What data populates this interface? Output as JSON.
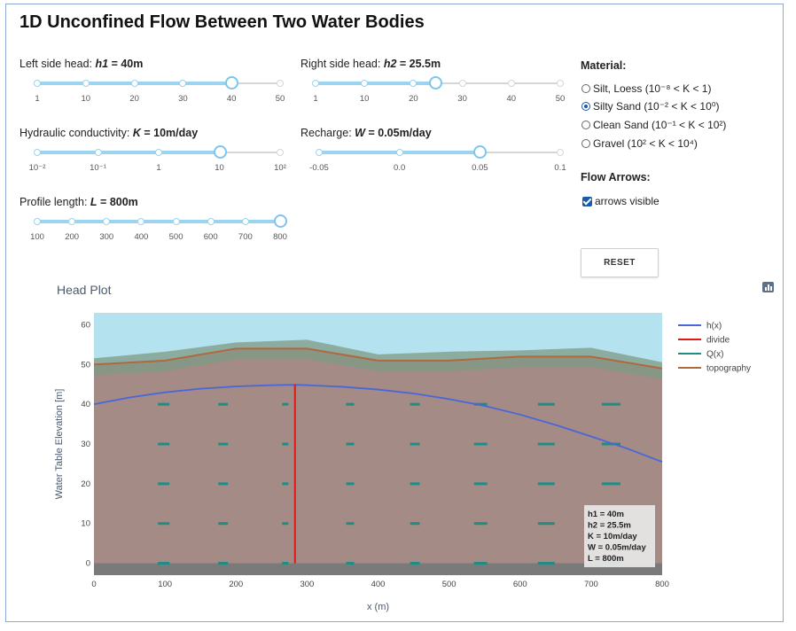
{
  "app_title": "1D Unconfined Flow Between Two Water Bodies",
  "controls": {
    "h1": {
      "label": "Left side head:",
      "var": "h1",
      "value": "= 40m",
      "ticks": [
        "1",
        "10",
        "20",
        "30",
        "40",
        "50"
      ],
      "fraction": 0.8
    },
    "h2": {
      "label": "Right side head:",
      "var": "h2",
      "value": "= 25.5m",
      "ticks": [
        "1",
        "10",
        "20",
        "30",
        "40",
        "50"
      ],
      "fraction": 0.49
    },
    "K": {
      "label": "Hydraulic conductivity:",
      "var": "K",
      "value": "= 10m/day",
      "ticks": [
        "10⁻²",
        "10⁻¹",
        "1",
        "10",
        "10²"
      ],
      "fraction": 0.75
    },
    "W": {
      "label": "Recharge:",
      "var": "W",
      "value": "= 0.05m/day",
      "ticks": [
        "-0.05",
        "0.0",
        "0.05",
        "0.1"
      ],
      "fraction": 0.667
    },
    "L": {
      "label": "Profile length:",
      "var": "L",
      "value": "= 800m",
      "ticks": [
        "100",
        "200",
        "300",
        "400",
        "500",
        "600",
        "700",
        "800"
      ],
      "fraction": 1.0
    }
  },
  "material": {
    "heading": "Material:",
    "options": [
      {
        "label": "Silt, Loess (10⁻⁸ < K < 1)",
        "selected": false
      },
      {
        "label": "Silty Sand (10⁻² < K < 10⁰)",
        "selected": true
      },
      {
        "label": "Clean Sand (10⁻¹ < K < 10²)",
        "selected": false
      },
      {
        "label": "Gravel (10² < K < 10⁴)",
        "selected": false
      }
    ]
  },
  "flow_arrows": {
    "heading": "Flow Arrows:",
    "checkbox_label": "arrows visible",
    "checked": true
  },
  "reset_label": "RESET",
  "plot": {
    "title": "Head Plot",
    "icon": "bar-chart-icon"
  },
  "chart_data": {
    "type": "line",
    "xlabel": "x (m)",
    "ylabel": "Water Table Elevation [m]",
    "xlim": [
      0,
      800
    ],
    "ylim": [
      -3,
      63
    ],
    "xticks": [
      0,
      100,
      200,
      300,
      400,
      500,
      600,
      700,
      800
    ],
    "yticks": [
      0,
      10,
      20,
      30,
      40,
      50,
      60
    ],
    "grid": false,
    "legend_position": "right",
    "series": [
      {
        "name": "h(x)",
        "color": "#4a66d8",
        "x": [
          0,
          50,
          100,
          150,
          200,
          250,
          285,
          300,
          350,
          400,
          450,
          500,
          550,
          600,
          650,
          700,
          750,
          800
        ],
        "y": [
          40,
          41.7,
          43,
          43.9,
          44.5,
          44.8,
          44.9,
          44.8,
          44.4,
          43.7,
          42.7,
          41.3,
          39.6,
          37.4,
          34.8,
          31.9,
          28.9,
          25.5
        ]
      },
      {
        "name": "divide",
        "color": "#e01818",
        "x": [
          283,
          283
        ],
        "y": [
          0,
          44.9
        ]
      },
      {
        "name": "Q(x)",
        "color": "#1f8c86",
        "x": [
          95,
          180,
          270,
          360,
          450,
          540,
          630,
          720
        ],
        "dx": [
          6,
          4,
          0,
          2,
          4,
          8,
          12,
          14
        ],
        "rows": [
          40,
          30,
          20,
          10,
          0
        ]
      },
      {
        "name": "topography",
        "color": "#b0683f",
        "x": [
          0,
          100,
          200,
          300,
          400,
          500,
          600,
          700,
          800
        ],
        "y": [
          50,
          51,
          54,
          54,
          51,
          51,
          52,
          52,
          49
        ]
      }
    ],
    "info_box": [
      "h1 = 40m",
      "h2 = 25.5m",
      "K = 10m/day",
      "W = 0.05m/day",
      "L = 800m"
    ],
    "colors": {
      "sky": "#b4e3ef",
      "soil": "#a48b85",
      "grass": "#7f9a85",
      "bedrock": "#7a7a7a"
    }
  }
}
